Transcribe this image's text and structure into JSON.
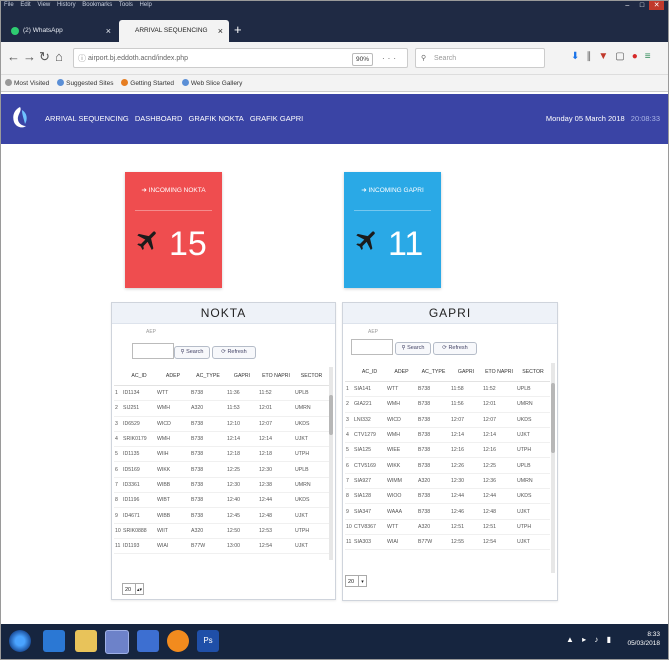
{
  "browser": {
    "menu": [
      "File",
      "Edit",
      "View",
      "History",
      "Bookmarks",
      "Tools",
      "Help"
    ],
    "tabs": [
      {
        "label": "(2) WhatsApp"
      },
      {
        "label": "ARRIVAL SEQUENCING"
      }
    ],
    "url": "airport.bj.eddoth.acnd/index.php",
    "zoom": "90%",
    "search_placeholder": "Search",
    "bookmarks": [
      "Most Visited",
      "Suggested Sites",
      "Getting Started",
      "Web Slice Gallery"
    ]
  },
  "app": {
    "nav": [
      "ARRIVAL SEQUENCING",
      "DASHBOARD",
      "GRAFIK NOKTA",
      "GRAFIK GAPRI"
    ],
    "date": "Monday 05 March 2018",
    "time": "20:08:33",
    "colors": {
      "header": "#3a44a5",
      "nokta_card": "#ef4d4f",
      "gapri_card": "#2aa9e6"
    }
  },
  "cards": {
    "nokta": {
      "label": "INCOMING NOKTA",
      "count": "15",
      "icon": "plane-icon"
    },
    "gapri": {
      "label": "INCOMING GAPRI",
      "count": "11",
      "icon": "plane-icon"
    }
  },
  "nokta": {
    "title": "NOKTA",
    "search_label": "AEP",
    "search_button": "Search",
    "refresh_button": "Refresh",
    "columns": [
      "AC_ID",
      "ADEP",
      "AC_TYPE",
      "GAPRI",
      "ETO NAPRI",
      "SECTOR"
    ],
    "rows": [
      [
        "1",
        "ID1134",
        "WTT",
        "B738",
        "11:36",
        "11:52",
        "UPLB"
      ],
      [
        "2",
        "SIJ251",
        "WMH",
        "A320",
        "11:53",
        "12:01",
        "UMRN"
      ],
      [
        "3",
        "ID6529",
        "WICD",
        "B738",
        "12:10",
        "12:07",
        "UKDS"
      ],
      [
        "4",
        "SRIK0179",
        "WMH",
        "B738",
        "12:14",
        "12:14",
        "UJKT"
      ],
      [
        "5",
        "ID1135",
        "WIIH",
        "B738",
        "12:18",
        "12:18",
        "UTPH"
      ],
      [
        "6",
        "ID5169",
        "WIKK",
        "B738",
        "12:25",
        "12:30",
        "UPLB"
      ],
      [
        "7",
        "ID3361",
        "WIBB",
        "B738",
        "12:30",
        "12:38",
        "UMRN"
      ],
      [
        "8",
        "ID1196",
        "WIBT",
        "B738",
        "12:40",
        "12:44",
        "UKDS"
      ],
      [
        "9",
        "ID4671",
        "WIBB",
        "B738",
        "12:45",
        "12:48",
        "UJKT"
      ],
      [
        "10",
        "SRIK0888",
        "WIIT",
        "A320",
        "12:50",
        "12:53",
        "UTPH"
      ],
      [
        "11",
        "ID1193",
        "WIAI",
        "B77W",
        "13:00",
        "12:54",
        "UJKT"
      ]
    ],
    "page_size": "20"
  },
  "gapri": {
    "title": "GAPRI",
    "search_label": "AEP",
    "search_button": "Search",
    "refresh_button": "Refresh",
    "columns": [
      "AC_ID",
      "ADEP",
      "AC_TYPE",
      "GAPRI",
      "ETO NAPRI",
      "SECTOR"
    ],
    "rows": [
      [
        "1",
        "SIA141",
        "WTT",
        "B738",
        "11:58",
        "11:52",
        "UPLB"
      ],
      [
        "2",
        "GIA221",
        "WMH",
        "B738",
        "11:56",
        "12:01",
        "UMRN"
      ],
      [
        "3",
        "LNI332",
        "WICD",
        "B738",
        "12:07",
        "12:07",
        "UKDS"
      ],
      [
        "4",
        "CTV1279",
        "WMH",
        "B738",
        "12:14",
        "12:14",
        "UJKT"
      ],
      [
        "5",
        "SIA125",
        "WIEE",
        "B738",
        "12:16",
        "12:16",
        "UTPH"
      ],
      [
        "6",
        "CTV5169",
        "WIKK",
        "B738",
        "12:26",
        "12:25",
        "UPLB"
      ],
      [
        "7",
        "SIA927",
        "WIMM",
        "A320",
        "12:30",
        "12:36",
        "UMRN"
      ],
      [
        "8",
        "SIA128",
        "WIOO",
        "B738",
        "12:44",
        "12:44",
        "UKDS"
      ],
      [
        "9",
        "SIA347",
        "WAAA",
        "B738",
        "12:46",
        "12:48",
        "UJKT"
      ],
      [
        "10",
        "CTV8367",
        "WTT",
        "A320",
        "12:51",
        "12:51",
        "UTPH"
      ],
      [
        "11",
        "SIA303",
        "WIAI",
        "B77W",
        "12:55",
        "12:54",
        "UJKT"
      ]
    ],
    "page_size": "20"
  },
  "taskbar": {
    "time": "8:33",
    "date": "05/03/2018"
  }
}
